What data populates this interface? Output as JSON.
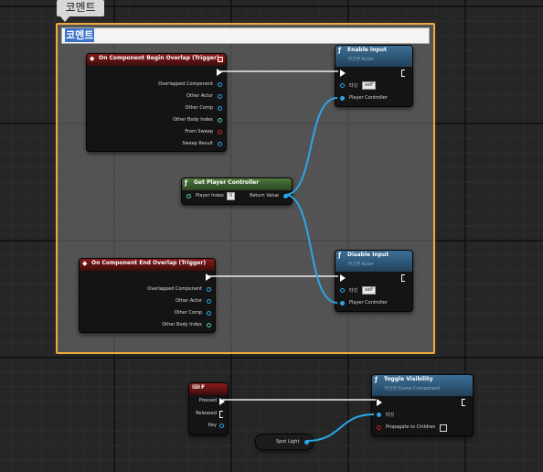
{
  "tooltip": "코멘트",
  "comment_title": "코멘트",
  "begin_overlap": {
    "title": "On Component Begin Overlap (Trigger)",
    "pins": [
      "Overlapped Component",
      "Other Actor",
      "Other Comp",
      "Other Body Index",
      "From Sweep",
      "Sweep Result"
    ]
  },
  "end_overlap": {
    "title": "On Component End Overlap (Trigger)",
    "pins": [
      "Overlapped Component",
      "Other Actor",
      "Other Comp",
      "Other Body Index"
    ]
  },
  "enable_input": {
    "title": "Enable Input",
    "subtitle": "타깃은 Actor",
    "target_label": "타깃",
    "target_value": "self",
    "player_controller": "Player Controller"
  },
  "disable_input": {
    "title": "Disable Input",
    "subtitle": "타깃은 Actor",
    "target_label": "타깃",
    "target_value": "self",
    "player_controller": "Player Controller"
  },
  "get_player_controller": {
    "title": "Get Player Controller",
    "player_index_label": "Player Index",
    "player_index_value": "0",
    "return_value": "Return Value"
  },
  "key_f": {
    "title": "F",
    "pressed": "Pressed",
    "released": "Released",
    "key": "Key"
  },
  "toggle_visibility": {
    "title": "Toggle Visibility",
    "subtitle": "타깃은 Scene Component",
    "target_label": "타깃",
    "propagate_label": "Propagate to Children"
  },
  "spot_light": "Spot Light",
  "colors": {
    "comment_border": "#f2a93b",
    "event_header": "#8a1a1a",
    "function_header": "#3c6f97",
    "pure_header": "#4d7a3a",
    "object_pin": "#2aa6e8",
    "int_pin": "#4bd39b",
    "bool_pin": "#c62626"
  }
}
